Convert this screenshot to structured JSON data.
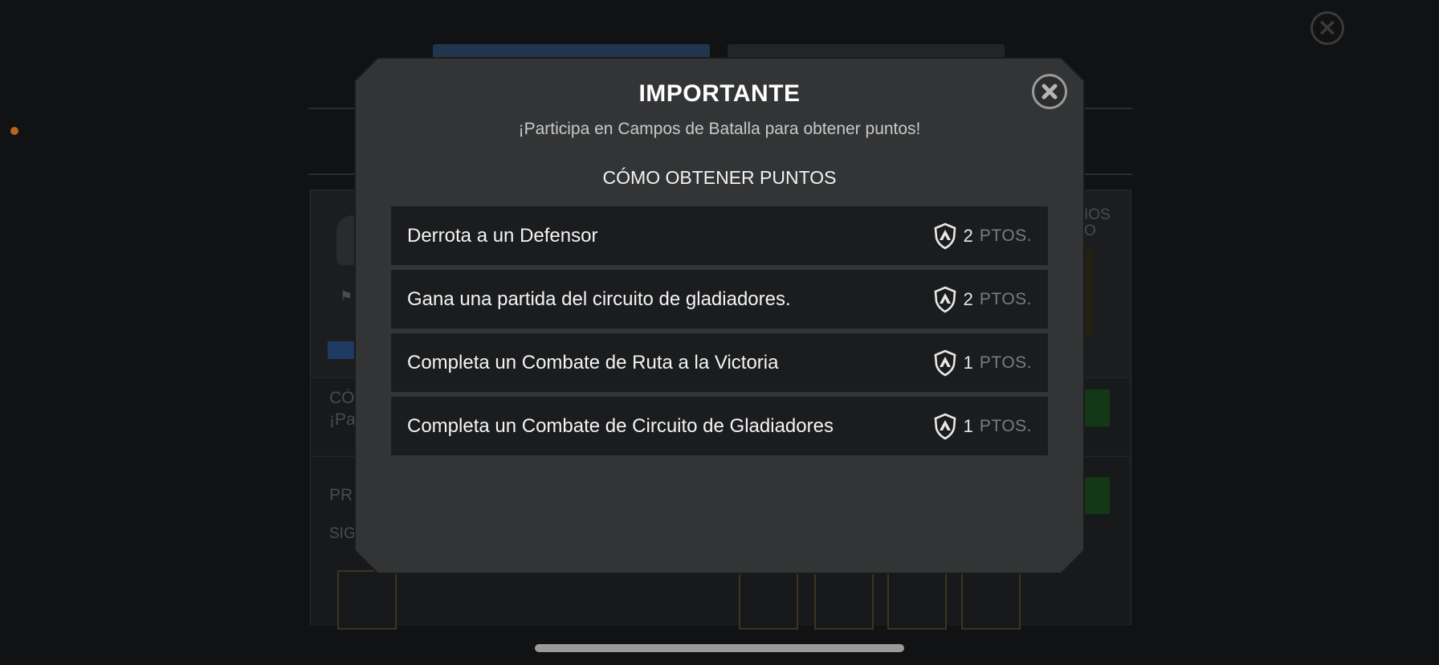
{
  "modal": {
    "title": "IMPORTANTE",
    "subtitle": "¡Participa en Campos de Batalla para obtener puntos!",
    "section_title": "CÓMO OBTENER PUNTOS",
    "close_icon": "close-x-icon"
  },
  "rows": [
    {
      "label": "Derrota a un Defensor",
      "points": "2",
      "unit": "PTOS."
    },
    {
      "label": "Gana una partida del circuito de gladiadores.",
      "points": "2",
      "unit": "PTOS."
    },
    {
      "label": "Completa un Combate de Ruta a la Victoria",
      "points": "1",
      "unit": "PTOS."
    },
    {
      "label": "Completa un Combate de Circuito de Gladiadores",
      "points": "1",
      "unit": "PTOS."
    }
  ],
  "background": {
    "fragment_1": "CÓ",
    "fragment_2": "¡Pa",
    "fragment_3": "PR",
    "fragment_4": "SIG",
    "fragment_5": "IOS",
    "fragment_6": "O"
  },
  "colors": {
    "modal_bg": "#333435",
    "row_bg": "#1b1c1e",
    "accent_orange": "#b5661e"
  }
}
